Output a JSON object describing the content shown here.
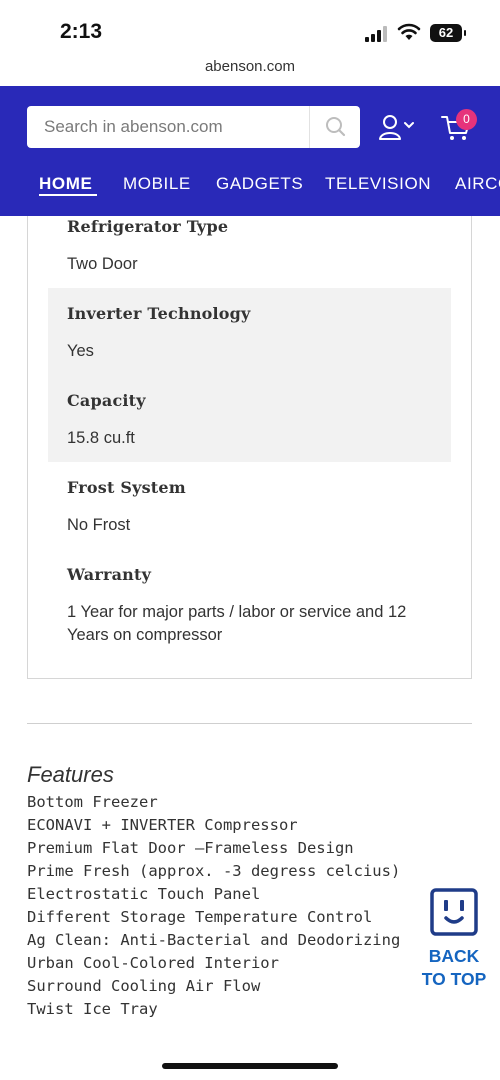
{
  "status_bar": {
    "time": "2:13",
    "battery": "62"
  },
  "browser": {
    "url": "abenson.com"
  },
  "header": {
    "search_placeholder": "Search in abenson.com",
    "cart_count": "0",
    "nav": [
      "HOME",
      "MOBILE",
      "GADGETS",
      "TELEVISION",
      "AIRCON"
    ],
    "active_nav": "HOME",
    "colors": {
      "header_bg": "#2929b8",
      "badge": "#e6337b"
    }
  },
  "specs": [
    {
      "label": "Refrigerator Type",
      "value": "Two Door"
    },
    {
      "label": "Inverter Technology",
      "value": "Yes"
    },
    {
      "label": "Capacity",
      "value": "15.8 cu.ft"
    },
    {
      "label": "Frost System",
      "value": "No Frost"
    },
    {
      "label": "Warranty",
      "value": "1 Year for major parts / labor or service and 12 Years on compressor"
    }
  ],
  "features": {
    "title": "Features",
    "items": [
      "Bottom Freezer",
      "ECONAVI + INVERTER Compressor",
      "Premium Flat Door –Frameless Design",
      "Prime Fresh (approx. -3 degress celcius)",
      "Electrostatic Touch Panel",
      "Different Storage Temperature Control",
      "Ag Clean: Anti-Bacterial and Deodorizing",
      "Urban Cool-Colored Interior",
      "Surround Cooling Air Flow",
      "Twist Ice Tray"
    ]
  },
  "back_to_top": {
    "line1": "BACK",
    "line2": "TO TOP",
    "icon": "outlet-face-icon",
    "color": "#1565c0"
  }
}
